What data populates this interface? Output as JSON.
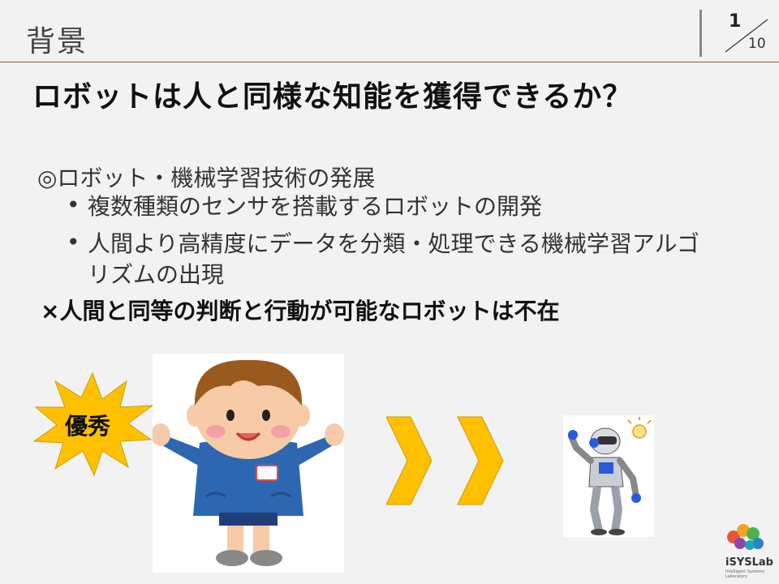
{
  "header": {
    "section_title": "背景",
    "page_number": "1",
    "page_total": "10"
  },
  "headline": "ロボットは人と同様な知能を獲得できるか？",
  "content": {
    "item1": "◎ロボット・機械学習技術の発展",
    "bullets": [
      "複数種類のセンサを搭載するロボットの開発",
      "人間より高精度にデータを分類・処理できる機械学習アルゴリズムの出現"
    ],
    "bullet_symbol": "•",
    "item2": "×人間と同等の判断と行動が可能なロボットは不在"
  },
  "illustration": {
    "burst_label": "優秀",
    "burst_color": "#ffc000",
    "chevron_color": "#ffc000"
  },
  "logo": {
    "name": "iSYSLab",
    "subtitle": "Intelligent Systems Laboratory"
  }
}
